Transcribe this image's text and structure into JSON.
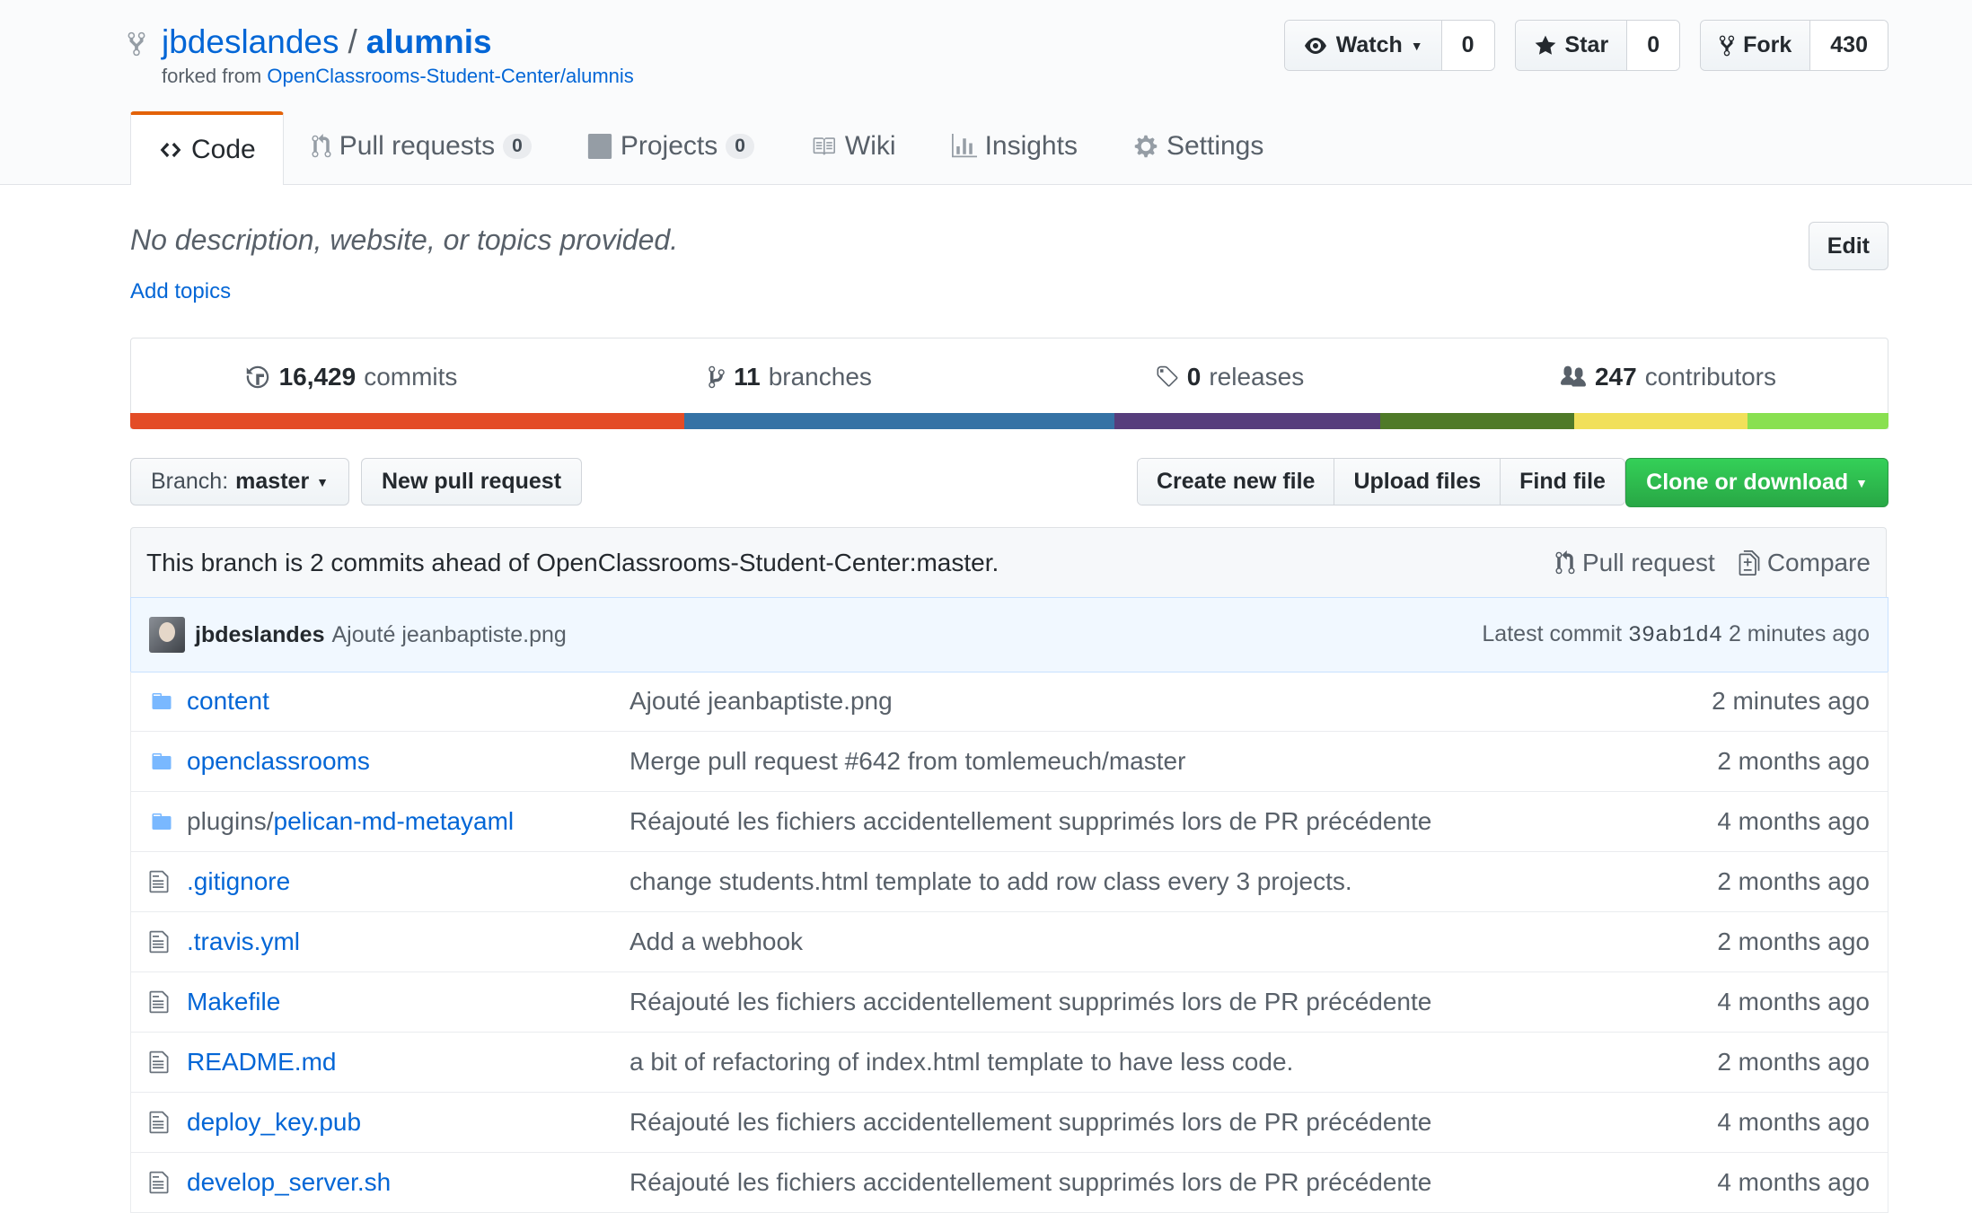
{
  "repo": {
    "owner": "jbdeslandes",
    "separator": "/",
    "name": "alumnis",
    "forked_prefix": "forked from",
    "forked_from": "OpenClassrooms-Student-Center/alumnis"
  },
  "actions": {
    "watch_label": "Watch",
    "watch_count": "0",
    "star_label": "Star",
    "star_count": "0",
    "fork_label": "Fork",
    "fork_count": "430"
  },
  "tabs": [
    {
      "label": "Code",
      "icon": "code-icon"
    },
    {
      "label": "Pull requests",
      "count": "0",
      "icon": "git-pull-request-icon"
    },
    {
      "label": "Projects",
      "count": "0",
      "icon": "project-icon"
    },
    {
      "label": "Wiki",
      "icon": "book-icon"
    },
    {
      "label": "Insights",
      "icon": "graph-icon"
    },
    {
      "label": "Settings",
      "icon": "gear-icon"
    }
  ],
  "description": {
    "text": "No description, website, or topics provided.",
    "add_topics": "Add topics",
    "edit_label": "Edit"
  },
  "summary": {
    "commits_count": "16,429",
    "commits_label": "commits",
    "branches_count": "11",
    "branches_label": "branches",
    "releases_count": "0",
    "releases_label": "releases",
    "contributors_count": "247",
    "contributors_label": "contributors"
  },
  "language_bar": [
    {
      "color": "#e34c26",
      "share": 0.315
    },
    {
      "color": "#3572A5",
      "share": 0.245
    },
    {
      "color": "#563d7c",
      "share": 0.151
    },
    {
      "color": "#4F7A28",
      "share": 0.11
    },
    {
      "color": "#f1e05a",
      "share": 0.099
    },
    {
      "color": "#89e051",
      "share": 0.08
    }
  ],
  "file_nav": {
    "branch_label": "Branch:",
    "branch_name": "master",
    "new_pr": "New pull request",
    "create_file": "Create new file",
    "upload_files": "Upload files",
    "find_file": "Find file",
    "clone": "Clone or download"
  },
  "branch_status": {
    "text": "This branch is 2 commits ahead of OpenClassrooms-Student-Center:master.",
    "pull_request": "Pull request",
    "compare": "Compare"
  },
  "latest_commit": {
    "author": "jbdeslandes",
    "message": "Ajouté jeanbaptiste.png",
    "label": "Latest commit",
    "sha": "39ab1d4",
    "age": "2 minutes ago"
  },
  "files": [
    {
      "type": "dir",
      "prefix": "",
      "name": "content",
      "message": "Ajouté jeanbaptiste.png",
      "age": "2 minutes ago"
    },
    {
      "type": "dir",
      "prefix": "",
      "name": "openclassrooms",
      "message": "Merge pull request #642 from tomlemeuch/master",
      "age": "2 months ago"
    },
    {
      "type": "dir",
      "prefix": "plugins/",
      "name": "pelican-md-metayaml",
      "message": "Réajouté les fichiers accidentellement supprimés lors de PR précédente",
      "age": "4 months ago"
    },
    {
      "type": "file",
      "prefix": "",
      "name": ".gitignore",
      "message": "change students.html template to add row class every 3 projects.",
      "age": "2 months ago"
    },
    {
      "type": "file",
      "prefix": "",
      "name": ".travis.yml",
      "message": "Add a webhook",
      "age": "2 months ago"
    },
    {
      "type": "file",
      "prefix": "",
      "name": "Makefile",
      "message": "Réajouté les fichiers accidentellement supprimés lors de PR précédente",
      "age": "4 months ago"
    },
    {
      "type": "file",
      "prefix": "",
      "name": "README.md",
      "message": "a bit of refactoring of index.html template to have less code.",
      "age": "2 months ago"
    },
    {
      "type": "file",
      "prefix": "",
      "name": "deploy_key.pub",
      "message": "Réajouté les fichiers accidentellement supprimés lors de PR précédente",
      "age": "4 months ago"
    },
    {
      "type": "file",
      "prefix": "",
      "name": "develop_server.sh",
      "message": "Réajouté les fichiers accidentellement supprimés lors de PR précédente",
      "age": "4 months ago"
    }
  ]
}
